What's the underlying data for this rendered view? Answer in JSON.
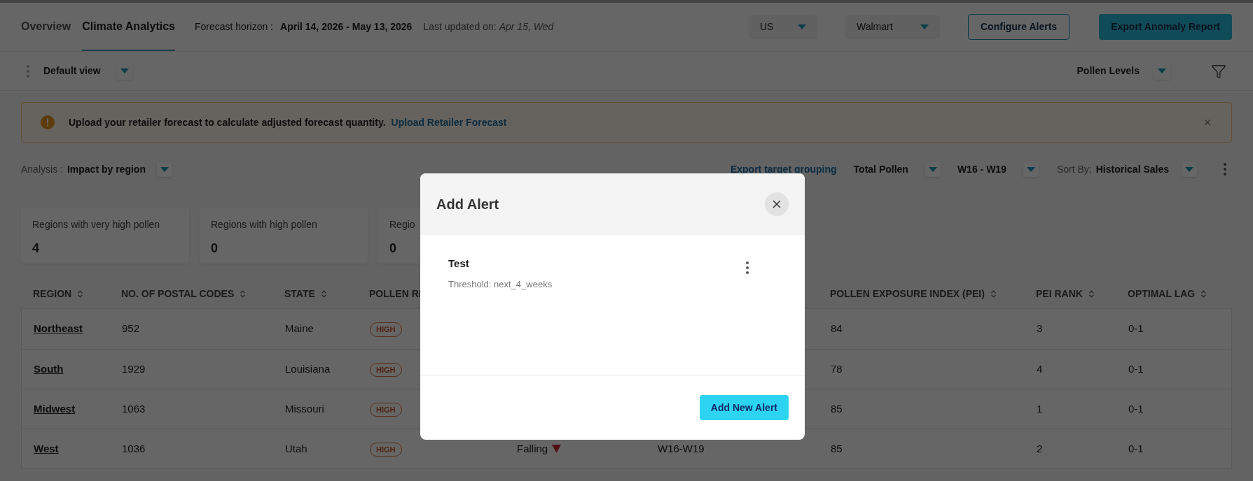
{
  "tabs": [
    {
      "label": "Overview",
      "selected": false
    },
    {
      "label": "Climate Analytics",
      "selected": true
    }
  ],
  "forecast": {
    "label": "Forecast horizon :",
    "value": "April 14, 2026 - May 13, 2026"
  },
  "last_updated": {
    "label": "Last updated on:",
    "value": "Apr 15, Wed"
  },
  "header_dropdowns": [
    {
      "value": "US"
    },
    {
      "value": "Walmart"
    }
  ],
  "header_buttons": [
    {
      "label": "Configure Alerts",
      "kind": "outline"
    },
    {
      "label": "Export Anomaly Report",
      "kind": "primary"
    }
  ],
  "view_selector": {
    "value": "Default view"
  },
  "layer_selector": {
    "value": "Pollen Levels"
  },
  "banner": {
    "message": "Upload your retailer forecast to calculate adjusted forecast quantity.",
    "link": "Upload Retailer Forecast"
  },
  "analysis": {
    "label": "Analysis :",
    "value": "Impact by region"
  },
  "export_link": "Export target grouping",
  "filters": [
    {
      "value": "Total Pollen"
    },
    {
      "value": "W16 - W19"
    }
  ],
  "sort": {
    "label": "Sort By:",
    "value": "Historical Sales"
  },
  "summary_cards": [
    {
      "label": "Regions with very high pollen",
      "value": "4"
    },
    {
      "label": "Regions with high pollen",
      "value": "0"
    },
    {
      "label": "Regio",
      "value": "0"
    }
  ],
  "table": {
    "columns": {
      "region": {
        "label": "REGION",
        "sort_icon": true
      },
      "postal_codes": {
        "label": "NO. OF POSTAL CODES",
        "sort_icon": true
      },
      "state": {
        "label": "STATE",
        "sort_icon": true
      },
      "pollen_risk": {
        "label": "POLLEN RI",
        "sort_icon": false
      },
      "pei": {
        "label": "POLLEN EXPOSURE INDEX (PEI)",
        "sort_icon": true
      },
      "pei_rank": {
        "label": "PEI RANK",
        "sort_icon": true
      },
      "optimal_lag": {
        "label": "OPTIMAL LAG",
        "sort_icon": true
      }
    },
    "rows": [
      {
        "region": "Northeast",
        "postal_codes": "952",
        "state": "Maine",
        "pollen_risk": "HIGH",
        "pei": "84",
        "pei_rank": "3",
        "optimal_lag": "0-1"
      },
      {
        "region": "South",
        "postal_codes": "1929",
        "state": "Louisiana",
        "pollen_risk": "HIGH",
        "pei": "78",
        "pei_rank": "4",
        "optimal_lag": "0-1"
      },
      {
        "region": "Midwest",
        "postal_codes": "1063",
        "state": "Missouri",
        "pollen_risk": "HIGH",
        "pei": "85",
        "pei_rank": "1",
        "optimal_lag": "0-1"
      },
      {
        "region": "West",
        "postal_codes": "1036",
        "state": "Utah",
        "pollen_risk": "HIGH",
        "column_5": {
          "text": "Falling",
          "kind": "down"
        },
        "column_6": "W16-W19",
        "pei": "85",
        "pei_rank": "2",
        "optimal_lag": "0-1"
      }
    ]
  },
  "modal": {
    "title": "Add Alert",
    "alerts": [
      {
        "name": "Test",
        "threshold": "Threshold: next_4_weeks"
      }
    ],
    "button": "Add New Alert"
  }
}
